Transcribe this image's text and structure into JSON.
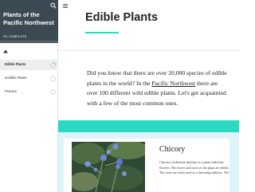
{
  "sidebar": {
    "course_title": "Plants of the Pacific Northwest",
    "progress_text": "0% COMPLETE",
    "progress_percent": 0,
    "collapse_icon": "caret-up-icon",
    "search_icon": "search-icon",
    "lessons": [
      {
        "label": "Edible Plants",
        "status": "in-progress",
        "active": true
      },
      {
        "label": "Inedible Plants",
        "status": "not-started",
        "active": false
      },
      {
        "label": "Practice",
        "status": "not-started",
        "active": false
      }
    ]
  },
  "main": {
    "menu_icon": "hamburger-icon",
    "lesson_title": "Edible Plants",
    "intro": {
      "before_link": "Did you know that there are over 20,000 species of edible plants in the world? In the ",
      "link_text": "Pacific Northwest",
      "after_link": " there are over 100 different wild edible plants. Let's get acquainted with a few of the most common ones."
    },
    "card": {
      "image_alt": "blue chicory flowers",
      "plant_name": "Chicory",
      "description": "Chicory (cichorium intybus) is a plant with blue flowers. The leaves and roots of the plant are edible. The roots are often used as a flavoring additive. The"
    }
  },
  "colors": {
    "sidebar_header": "#3b4a52",
    "accent": "#2ad9c2",
    "card_background": "#dff3fb"
  }
}
